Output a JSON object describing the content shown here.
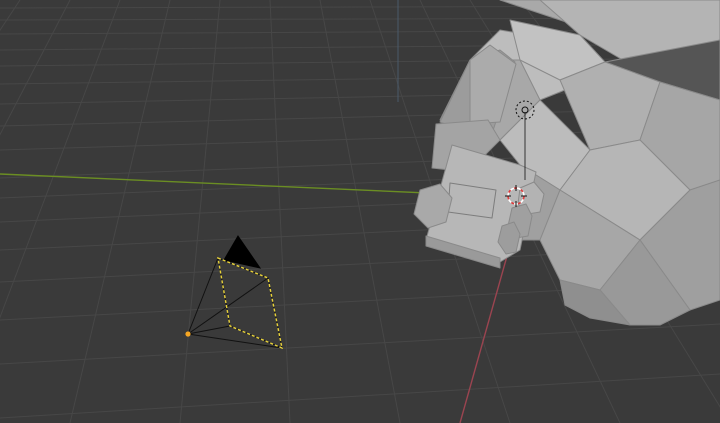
{
  "app": {
    "name": "",
    "view": "3d-viewport"
  },
  "colors": {
    "background": "#3a3a3a",
    "grid_line": "#474747",
    "x_axis": "#9b4450",
    "y_axis": "#6b8e23",
    "z_axis": "#4a6a9b",
    "mesh_light": "#b8b8b8",
    "mesh_mid": "#a2a2a2",
    "mesh_dark": "#6c6c6c",
    "mesh_edge": "#909090",
    "camera_wire": "#111111",
    "camera_selected": "#e8d23a",
    "camera_origin": "#f5a623",
    "cursor_red": "#e03a3a"
  },
  "objects": [
    {
      "id": "camera",
      "icon": "camera-icon",
      "selected": true
    },
    {
      "id": "mesh",
      "icon": "mesh-icon",
      "selected": false
    },
    {
      "id": "light",
      "icon": "light-icon",
      "selected": false
    },
    {
      "id": "3d-cursor",
      "icon": "crosshair-icon",
      "selected": false
    }
  ]
}
